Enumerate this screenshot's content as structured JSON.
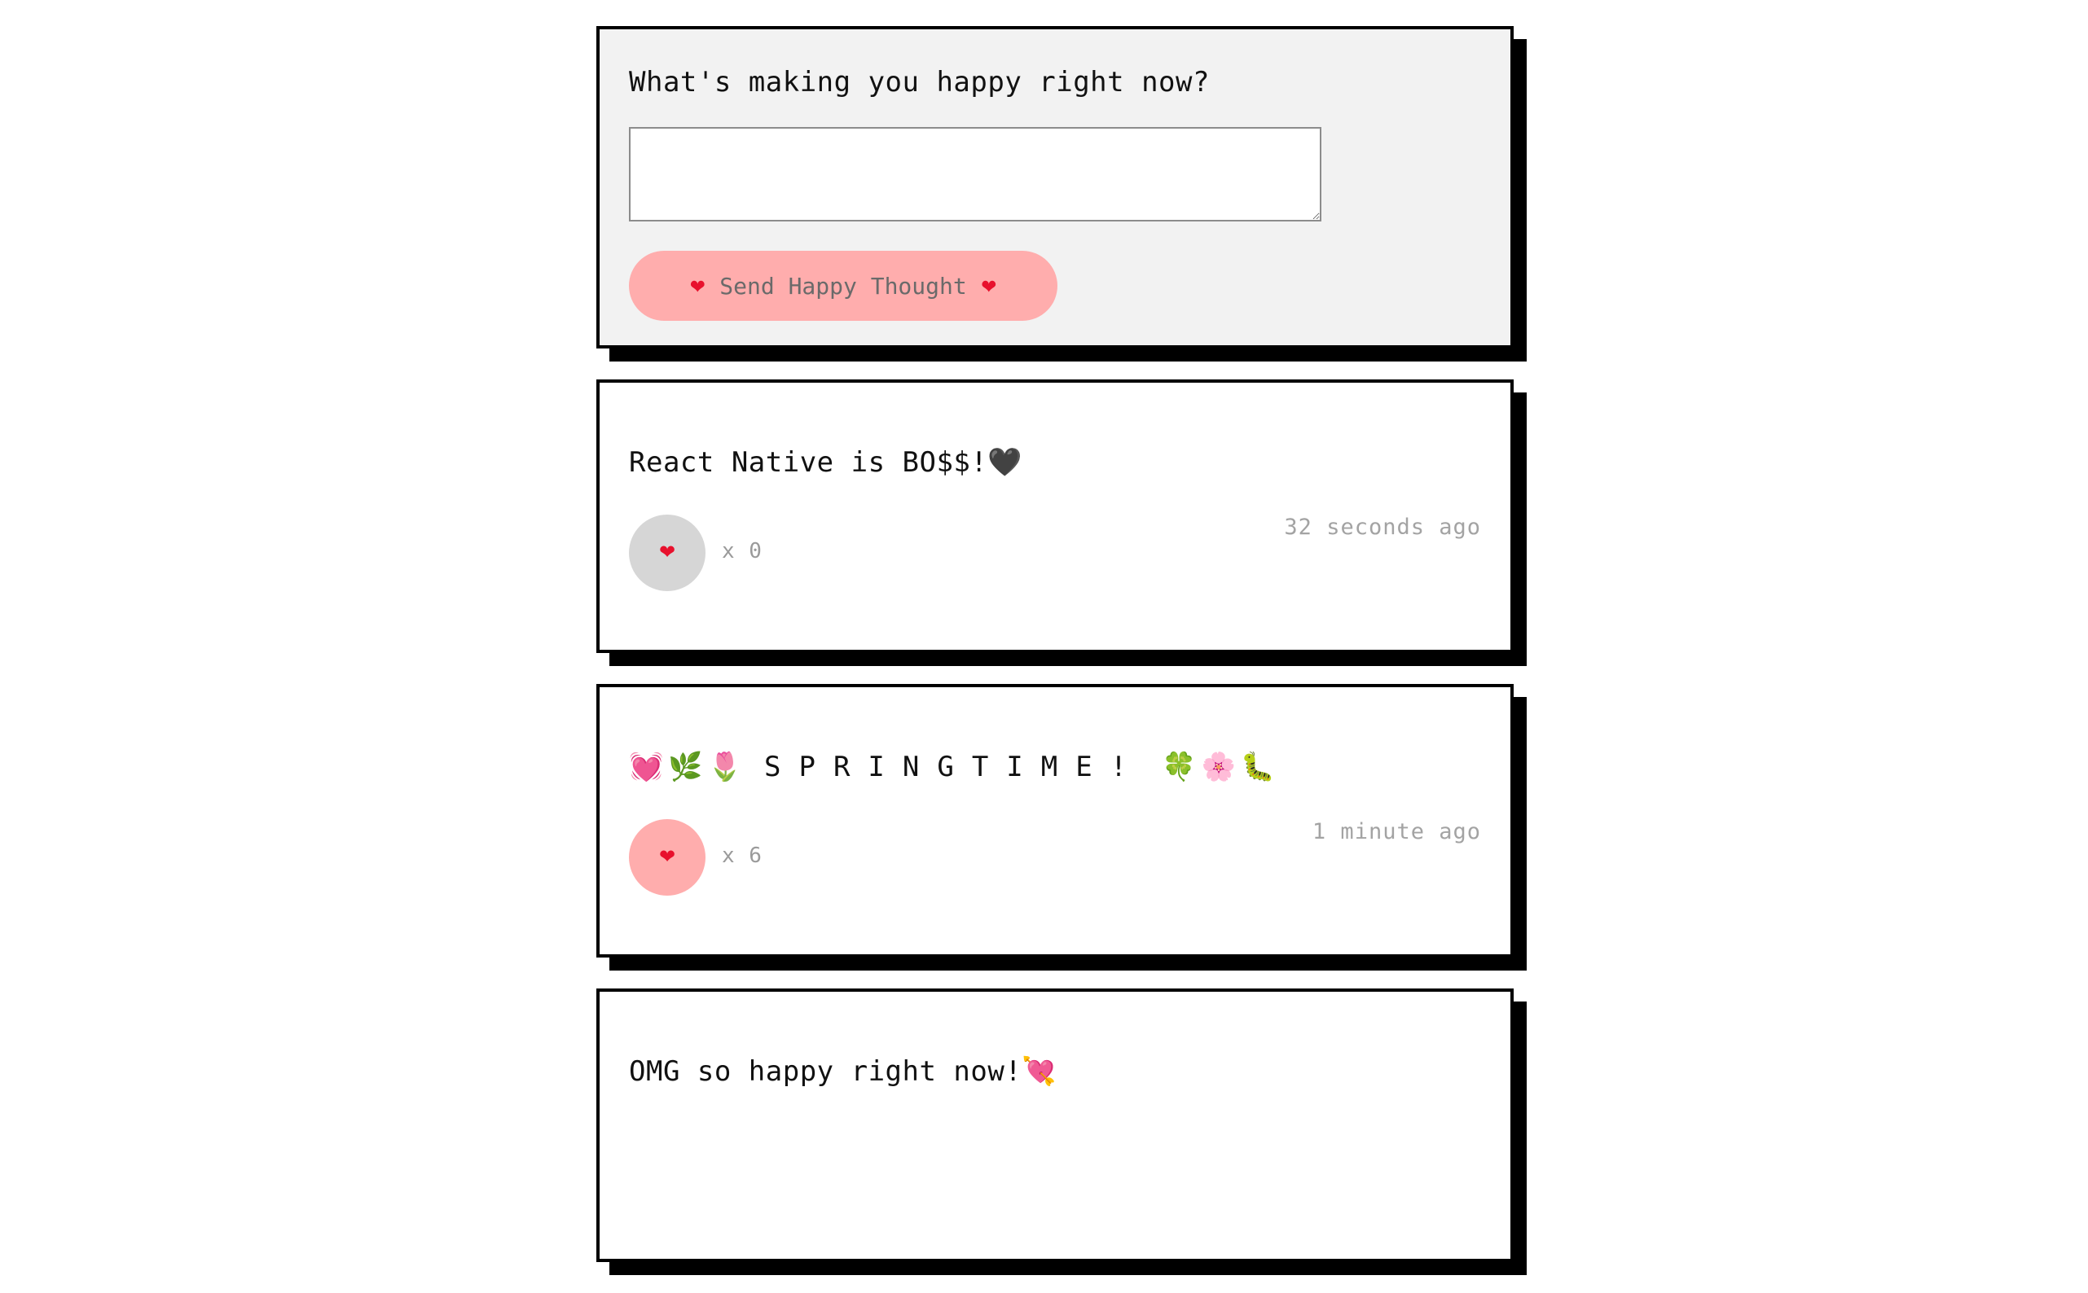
{
  "form": {
    "question": "What's making you happy right now?",
    "input_value": "",
    "button_label": "Send Happy Thought",
    "button_icon": "heart-icon"
  },
  "thoughts": [
    {
      "message": "React Native is BO$$!🖤",
      "likes": "x 0",
      "liked": false,
      "time": "32 seconds ago"
    },
    {
      "message_emoji_before": "💓🌿🌷",
      "message_text": "SPRINGTIME!",
      "message_emoji_after": "🍀🌸🐛",
      "likes": "x 6",
      "liked": true,
      "time": "1 minute ago"
    },
    {
      "message": "OMG so happy right now!💘"
    }
  ],
  "colors": {
    "accent": "#ffadad",
    "unliked": "#d6d6d6",
    "heart": "#e8112d",
    "shadow": "#000000"
  }
}
